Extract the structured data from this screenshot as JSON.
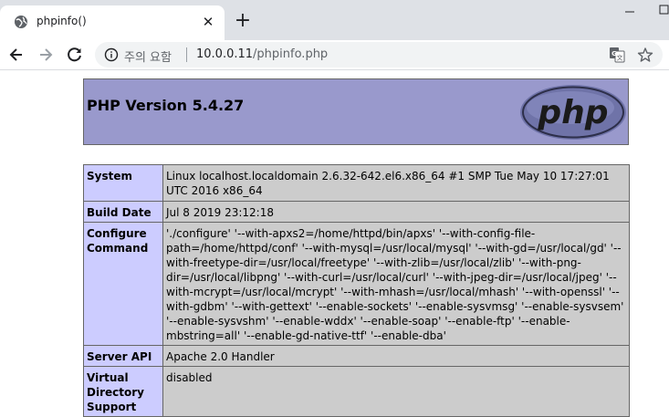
{
  "browser": {
    "tab_title": "phpinfo()",
    "security_label": "주의 요함",
    "url_host": "10.0.0.11",
    "url_path": "/phpinfo.php"
  },
  "page": {
    "version_heading": "PHP Version 5.4.27",
    "logo_text": "php",
    "rows": [
      {
        "key": "System",
        "value": "Linux localhost.localdomain 2.6.32-642.el6.x86_64 #1 SMP Tue May 10 17:27:01 UTC 2016 x86_64"
      },
      {
        "key": "Build Date",
        "value": "Jul 8 2019 23:12:18"
      },
      {
        "key": "Configure Command",
        "value": "'./configure' '--with-apxs2=/home/httpd/bin/apxs' '--with-config-file-path=/home/httpd/conf' '--with-mysql=/usr/local/mysql' '--with-gd=/usr/local/gd' '--with-freetype-dir=/usr/local/freetype' '--with-zlib=/usr/local/zlib' '--with-png-dir=/usr/local/libpng' '--with-curl=/usr/local/curl' '--with-jpeg-dir=/usr/local/jpeg' '--with-mcrypt=/usr/local/mcrypt' '--with-mhash=/usr/local/mhash' '--with-openssl' '--with-gdbm' '--with-gettext' '--enable-sockets' '--enable-sysvmsg' '--enable-sysvsem' '--enable-sysvshm' '--enable-wddx' '--enable-soap' '--enable-ftp' '--enable-mbstring=all' '--enable-gd-native-ttf' '--enable-dba'"
      },
      {
        "key": "Server API",
        "value": "Apache 2.0 Handler"
      },
      {
        "key": "Virtual Directory Support",
        "value": "disabled"
      }
    ]
  },
  "colors": {
    "header_bg": "#9999cc",
    "key_bg": "#ccccff",
    "value_bg": "#cccccc"
  }
}
